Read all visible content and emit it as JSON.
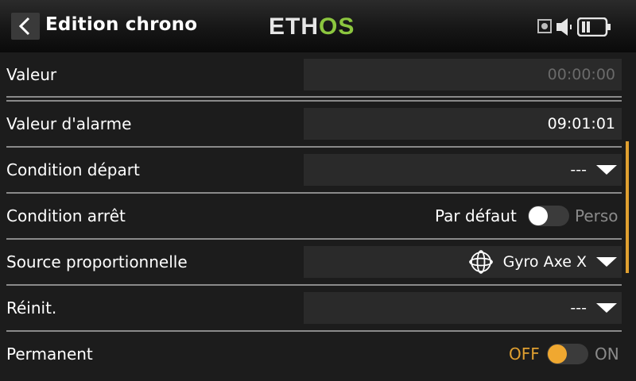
{
  "header": {
    "title": "Edition chrono",
    "logo_left": "ETH",
    "logo_right": "OS",
    "back_icon": "chevron-left-icon",
    "icons": [
      "record-icon",
      "speaker-icon",
      "battery-icon"
    ]
  },
  "rows": [
    {
      "label": "Valeur",
      "value": "00:00:00"
    },
    {
      "label": "Valeur d'alarme",
      "value": "09:01:01"
    },
    {
      "label": "Condition départ",
      "value": "---"
    },
    {
      "label": "Condition arrêt",
      "left_text": "Par défaut",
      "right_text": "Perso"
    },
    {
      "label": "Source proportionnelle",
      "value": "Gyro Axe X",
      "icon": "gyro-icon"
    },
    {
      "label": "Réinit.",
      "value": "---"
    },
    {
      "label": "Permanent",
      "left_text": "OFF",
      "right_text": "ON"
    }
  ],
  "colors": {
    "accent": "#e0a030",
    "logo_green": "#8cc63f",
    "background": "#1c1c1c",
    "field": "#2a2a2a",
    "header": "#161616"
  }
}
